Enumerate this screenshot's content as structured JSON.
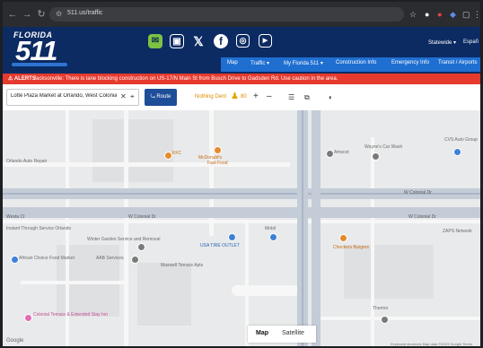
{
  "browser": {
    "url": "511.us/traffic"
  },
  "site": {
    "logo_word": "FLORIDA",
    "logo_number": "511",
    "social": {
      "email": "✉",
      "phone": "▣",
      "x": "𝕏",
      "facebook": "f",
      "instagram": "◎",
      "youtube": "▶"
    },
    "lang_statewide": "Statewide ▾",
    "lang_espanol": "Españ",
    "menu": [
      "Map",
      "Traffic ▾",
      "My Florida 511 ▾",
      "Construction Info",
      "Emergency Info",
      "Transit / Airports"
    ]
  },
  "alert": {
    "label": "⚠ ALERTS",
    "text": "Jacksonville: There is lane blocking construction on US-17/N Main St from Busch Drive to Gadsden Rd. Use caution in the area."
  },
  "toolbar": {
    "search_value": "Lotte Plaza Market at Orlando, West Colonial",
    "clear": "✕",
    "pin": "⌖",
    "route_label": "⤿ Route",
    "locate": "◎",
    "parking_label": "Nothing Dent",
    "amber_value": "80",
    "zoom_in": "+",
    "zoom_out": "–",
    "list_icon": "☰",
    "layers_icon": "⧉",
    "contrast_icon": "◐"
  },
  "map": {
    "pois": [
      {
        "label": "Orlando Auto Repair",
        "type": "grey"
      },
      {
        "label": "KFC",
        "type": "orange"
      },
      {
        "label": "McDonald's",
        "type": "orange"
      },
      {
        "label": "Fast Food",
        "type": "orange"
      },
      {
        "label": "Amscot",
        "type": "grey"
      },
      {
        "label": "Wayne's Car Wash",
        "type": "grey"
      },
      {
        "label": "CVS Auto Group",
        "type": "blue"
      },
      {
        "label": "Instant Through Service Orlando",
        "type": "grey"
      },
      {
        "label": "Winter Garden Service and Removal",
        "type": "grey"
      },
      {
        "label": "AAB Services",
        "type": "grey"
      },
      {
        "label": "USA TIRE OUTLET",
        "type": "blue"
      },
      {
        "label": "Mobil",
        "type": "blue"
      },
      {
        "label": "Checkers Burgers",
        "type": "orange"
      },
      {
        "label": "ZAPS Network",
        "type": "grey"
      },
      {
        "label": "African Choice Food Market",
        "type": "blue"
      },
      {
        "label": "Maxwell Terrace Apts",
        "type": "grey"
      },
      {
        "label": "Colonial Terrace & Extended Stay Inn",
        "type": "pink"
      },
      {
        "label": "Thermo",
        "type": "grey"
      }
    ],
    "streets": [
      "W Colonial Dr",
      "W Colonial Dr",
      "W Colonial Dr",
      "Westa Ct"
    ],
    "map_label": "Map",
    "satellite_label": "Satellite",
    "google": "Google",
    "footer": "Keyboard shortcuts   Map data ©2023 Google   Terms"
  },
  "colors": {
    "header_bg": "#0c2b63",
    "menu_bg": "#1f6fd1",
    "alert_bg": "#e63a2e",
    "route_btn": "#1f4e99"
  }
}
